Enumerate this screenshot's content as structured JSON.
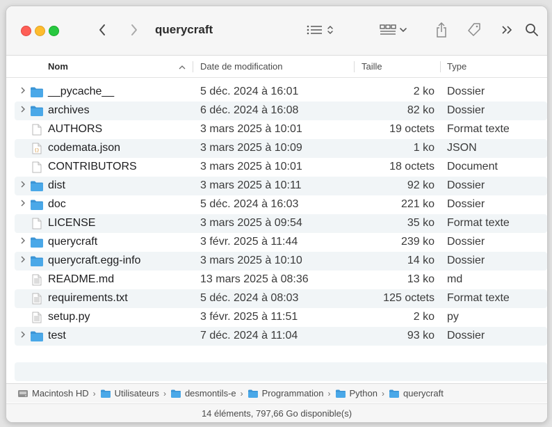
{
  "window": {
    "title": "querycraft"
  },
  "toolbar": {
    "icons": [
      "back-icon",
      "forward-icon",
      "list-view-icon",
      "group-icon",
      "share-icon",
      "tag-icon",
      "more-icon",
      "search-icon"
    ]
  },
  "columns": {
    "name": "Nom",
    "date": "Date de modification",
    "size": "Taille",
    "kind": "Type"
  },
  "files": [
    {
      "name": "__pycache__",
      "date": "5 déc. 2024 à 16:01",
      "size": "2 ko",
      "kind": "Dossier",
      "icon": "folder"
    },
    {
      "name": "archives",
      "date": "6 déc. 2024 à 16:08",
      "size": "82 ko",
      "kind": "Dossier",
      "icon": "folder"
    },
    {
      "name": "AUTHORS",
      "date": "3 mars 2025 à 10:01",
      "size": "19 octets",
      "kind": "Format texte",
      "icon": "doc"
    },
    {
      "name": "codemata.json",
      "date": "3 mars 2025 à 10:09",
      "size": "1 ko",
      "kind": "JSON",
      "icon": "json"
    },
    {
      "name": "CONTRIBUTORS",
      "date": "3 mars 2025 à 10:01",
      "size": "18 octets",
      "kind": "Document",
      "icon": "doc"
    },
    {
      "name": "dist",
      "date": "3 mars 2025 à 10:11",
      "size": "92 ko",
      "kind": "Dossier",
      "icon": "folder"
    },
    {
      "name": "doc",
      "date": "5 déc. 2024 à 16:03",
      "size": "221 ko",
      "kind": "Dossier",
      "icon": "folder"
    },
    {
      "name": "LICENSE",
      "date": "3 mars 2025 à 09:54",
      "size": "35 ko",
      "kind": "Format texte",
      "icon": "doc"
    },
    {
      "name": "querycraft",
      "date": "3 févr. 2025 à 11:44",
      "size": "239 ko",
      "kind": "Dossier",
      "icon": "folder"
    },
    {
      "name": "querycraft.egg-info",
      "date": "3 mars 2025 à 10:10",
      "size": "14 ko",
      "kind": "Dossier",
      "icon": "folder"
    },
    {
      "name": "README.md",
      "date": "13 mars 2025 à 08:36",
      "size": "13 ko",
      "kind": "md",
      "icon": "text"
    },
    {
      "name": "requirements.txt",
      "date": "5 déc. 2024 à 08:03",
      "size": "125 octets",
      "kind": "Format texte",
      "icon": "text"
    },
    {
      "name": "setup.py",
      "date": "3 févr. 2025 à 11:51",
      "size": "2 ko",
      "kind": "py",
      "icon": "text"
    },
    {
      "name": "test",
      "date": "7 déc. 2024 à 11:04",
      "size": "93 ko",
      "kind": "Dossier",
      "icon": "folder"
    }
  ],
  "path": [
    "Macintosh HD",
    "Utilisateurs",
    "desmontils-e",
    "Programmation",
    "Python",
    "querycraft"
  ],
  "status": "14 éléments, 797,66 Go disponible(s)",
  "colors": {
    "folder": "#4aa8e8",
    "folder_tab": "#3b95d6",
    "alt_row": "#f1f5f7"
  }
}
